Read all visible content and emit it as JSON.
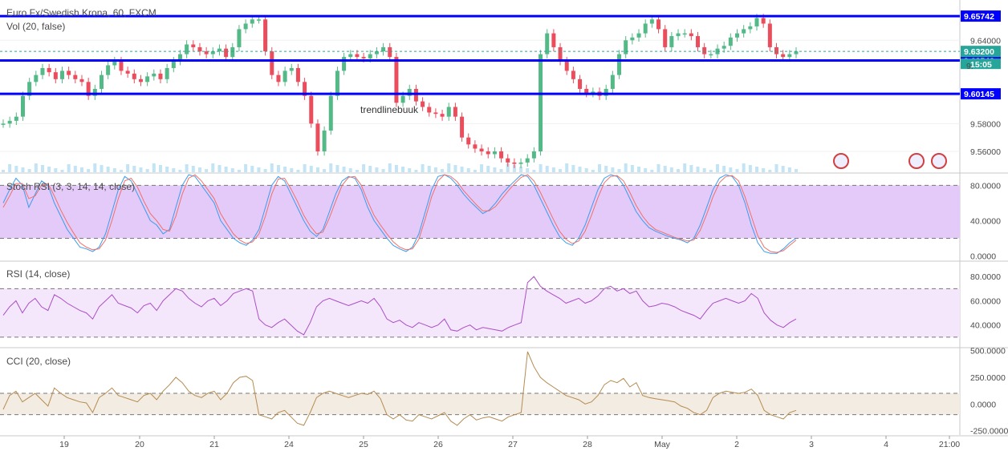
{
  "header": {
    "title": "Euro Fx/Swedish Krona, 60, FXCM",
    "vol_label": "Vol (20, false)"
  },
  "annotation": "trendlinebuuk",
  "colors": {
    "up": "#53b987",
    "down": "#eb4d5c",
    "level_line": "#0000ff",
    "stoch_k": "#3b9cf0",
    "stoch_d": "#f0706a",
    "rsi": "#aa4fc6",
    "cci": "#b58b50",
    "stoch_band": "#e4caf8",
    "rsi_band": "#f4e6fb",
    "cci_band": "#f3ece2",
    "current_price": "#26a69a"
  },
  "chart_data": {
    "type": "candlestick",
    "main": {
      "ylim": [
        9.545,
        9.669
      ],
      "ticks": [
        "9.56000",
        "9.58000",
        "9.60000",
        "9.64000"
      ],
      "levels": [
        {
          "value": 9.65742,
          "label": "9.65742"
        },
        {
          "value": 9.62542,
          "label": "9.62542"
        },
        {
          "value": 9.60145,
          "label": "9.60145"
        }
      ],
      "current_price": {
        "value": 9.632,
        "label": "9.63200"
      },
      "countdown": "15:05",
      "partial_tag": "9.",
      "series_closes": [
        9.58,
        9.582,
        9.585,
        9.6,
        9.61,
        9.615,
        9.62,
        9.617,
        9.612,
        9.618,
        9.615,
        9.612,
        9.61,
        9.6,
        9.605,
        9.615,
        9.622,
        9.625,
        9.618,
        9.616,
        9.612,
        9.61,
        9.614,
        9.616,
        9.612,
        9.62,
        9.625,
        9.63,
        9.637,
        9.635,
        9.632,
        9.63,
        9.632,
        9.634,
        9.628,
        9.635,
        9.648,
        9.652,
        9.655,
        9.655,
        9.632,
        9.615,
        9.61,
        9.618,
        9.62,
        9.61,
        9.6,
        9.58,
        9.56,
        9.575,
        9.6,
        9.618,
        9.628,
        9.63,
        9.628,
        9.627,
        9.63,
        9.632,
        9.635,
        9.628,
        9.595,
        9.6,
        9.605,
        9.596,
        9.592,
        9.588,
        9.587,
        9.585,
        9.592,
        9.585,
        9.57,
        9.565,
        9.562,
        9.56,
        9.558,
        9.56,
        9.555,
        9.552,
        9.551,
        9.552,
        9.555,
        9.56,
        9.63,
        9.645,
        9.635,
        9.625,
        9.618,
        9.612,
        9.605,
        9.602,
        9.603,
        9.6,
        9.605,
        9.615,
        9.63,
        9.64,
        9.642,
        9.645,
        9.652,
        9.655,
        9.648,
        9.635,
        9.643,
        9.645,
        9.645,
        9.643,
        9.635,
        9.63,
        9.63,
        9.634,
        9.636,
        9.642,
        9.645,
        9.648,
        9.65,
        9.656,
        9.652,
        9.635,
        9.63,
        9.628,
        9.63,
        9.632
      ],
      "volume_spikes_visible": true
    },
    "indicators": [
      {
        "name": "Stoch RSI (3, 3, 14, 14, close)",
        "ylim": [
          -5,
          93
        ],
        "ticks": [
          "80.0000",
          "40.0000",
          "0.0000"
        ],
        "band": [
          20,
          80
        ],
        "series_k": [
          60,
          75,
          88,
          80,
          55,
          70,
          85,
          80,
          60,
          45,
          30,
          20,
          10,
          8,
          5,
          10,
          25,
          50,
          75,
          90,
          85,
          70,
          55,
          40,
          35,
          25,
          30,
          55,
          80,
          92,
          90,
          80,
          70,
          60,
          40,
          30,
          20,
          15,
          12,
          18,
          30,
          55,
          80,
          90,
          85,
          70,
          55,
          40,
          28,
          22,
          30,
          50,
          70,
          85,
          90,
          88,
          75,
          55,
          40,
          30,
          20,
          12,
          8,
          5,
          10,
          25,
          50,
          75,
          90,
          92,
          88,
          80,
          70,
          62,
          55,
          48,
          52,
          60,
          70,
          78,
          85,
          92,
          90,
          80,
          65,
          50,
          35,
          22,
          15,
          12,
          20,
          35,
          55,
          75,
          88,
          92,
          90,
          80,
          65,
          50,
          40,
          32,
          28,
          25,
          22,
          20,
          18,
          15,
          20,
          35,
          55,
          75,
          88,
          92,
          90,
          80,
          60,
          35,
          15,
          5,
          3,
          3,
          8,
          15,
          20
        ],
        "series_d": [
          55,
          68,
          82,
          82,
          65,
          68,
          80,
          82,
          68,
          52,
          38,
          26,
          15,
          10,
          7,
          8,
          18,
          40,
          65,
          85,
          88,
          78,
          62,
          48,
          40,
          30,
          28,
          45,
          70,
          88,
          92,
          85,
          75,
          65,
          48,
          36,
          25,
          18,
          14,
          16,
          25,
          45,
          70,
          87,
          88,
          76,
          62,
          46,
          34,
          25,
          27,
          43,
          62,
          80,
          89,
          90,
          80,
          62,
          46,
          35,
          25,
          16,
          10,
          7,
          8,
          19,
          42,
          67,
          85,
          92,
          90,
          84,
          74,
          66,
          58,
          51,
          51,
          56,
          65,
          74,
          82,
          89,
          92,
          85,
          72,
          57,
          42,
          28,
          19,
          14,
          17,
          28,
          46,
          66,
          83,
          90,
          91,
          85,
          72,
          57,
          45,
          36,
          30,
          27,
          24,
          21,
          19,
          17,
          18,
          29,
          47,
          67,
          83,
          90,
          91,
          85,
          67,
          45,
          23,
          10,
          5,
          4,
          6,
          12,
          18
        ]
      },
      {
        "name": "RSI (14, close)",
        "ylim": [
          22,
          92
        ],
        "ticks": [
          "80.0000",
          "60.0000",
          "40.0000"
        ],
        "band": [
          30,
          70
        ],
        "series": [
          48,
          55,
          60,
          50,
          58,
          62,
          55,
          52,
          65,
          62,
          58,
          55,
          52,
          50,
          45,
          55,
          60,
          65,
          58,
          56,
          54,
          50,
          56,
          58,
          52,
          60,
          65,
          70,
          68,
          62,
          58,
          55,
          60,
          62,
          56,
          60,
          66,
          68,
          70,
          68,
          45,
          40,
          38,
          42,
          45,
          40,
          35,
          32,
          42,
          55,
          60,
          62,
          60,
          58,
          56,
          58,
          60,
          58,
          62,
          55,
          45,
          42,
          44,
          40,
          38,
          42,
          40,
          38,
          40,
          45,
          36,
          35,
          38,
          40,
          36,
          38,
          37,
          36,
          35,
          38,
          40,
          42,
          75,
          80,
          72,
          68,
          65,
          62,
          58,
          60,
          62,
          58,
          60,
          64,
          70,
          72,
          68,
          70,
          66,
          68,
          60,
          55,
          56,
          58,
          57,
          55,
          52,
          50,
          48,
          45,
          52,
          58,
          60,
          62,
          60,
          58,
          60,
          66,
          62,
          50,
          44,
          40,
          38,
          42,
          45
        ]
      },
      {
        "name": "CCI (20, close)",
        "ylim": [
          -290,
          520
        ],
        "ticks": [
          "500.0000",
          "250.0000",
          "0.0000",
          "-250.0000"
        ],
        "band": [
          -100,
          100
        ],
        "series": [
          -50,
          80,
          120,
          20,
          60,
          100,
          40,
          -20,
          150,
          100,
          60,
          40,
          20,
          10,
          -80,
          60,
          100,
          150,
          80,
          60,
          40,
          20,
          80,
          100,
          40,
          120,
          180,
          250,
          200,
          120,
          80,
          60,
          100,
          120,
          40,
          100,
          200,
          250,
          260,
          220,
          -100,
          -120,
          -140,
          -80,
          -60,
          -120,
          -180,
          -200,
          -80,
          60,
          100,
          120,
          100,
          80,
          60,
          80,
          100,
          90,
          120,
          50,
          -100,
          -140,
          -100,
          -150,
          -160,
          -100,
          -120,
          -140,
          -110,
          -80,
          -160,
          -200,
          -140,
          -100,
          -150,
          -130,
          -120,
          -140,
          -160,
          -120,
          -100,
          -80,
          490,
          350,
          250,
          200,
          160,
          120,
          80,
          60,
          40,
          0,
          20,
          80,
          180,
          220,
          200,
          240,
          160,
          200,
          80,
          60,
          50,
          40,
          30,
          20,
          -20,
          -40,
          -80,
          -100,
          -60,
          60,
          100,
          120,
          110,
          100,
          110,
          140,
          80,
          -60,
          -100,
          -120,
          -140,
          -80,
          -60
        ]
      }
    ],
    "x_tick_labels": [
      "19",
      "20",
      "21",
      "24",
      "25",
      "26",
      "27",
      "28",
      "May",
      "2",
      "3",
      "4",
      "21:00"
    ]
  }
}
